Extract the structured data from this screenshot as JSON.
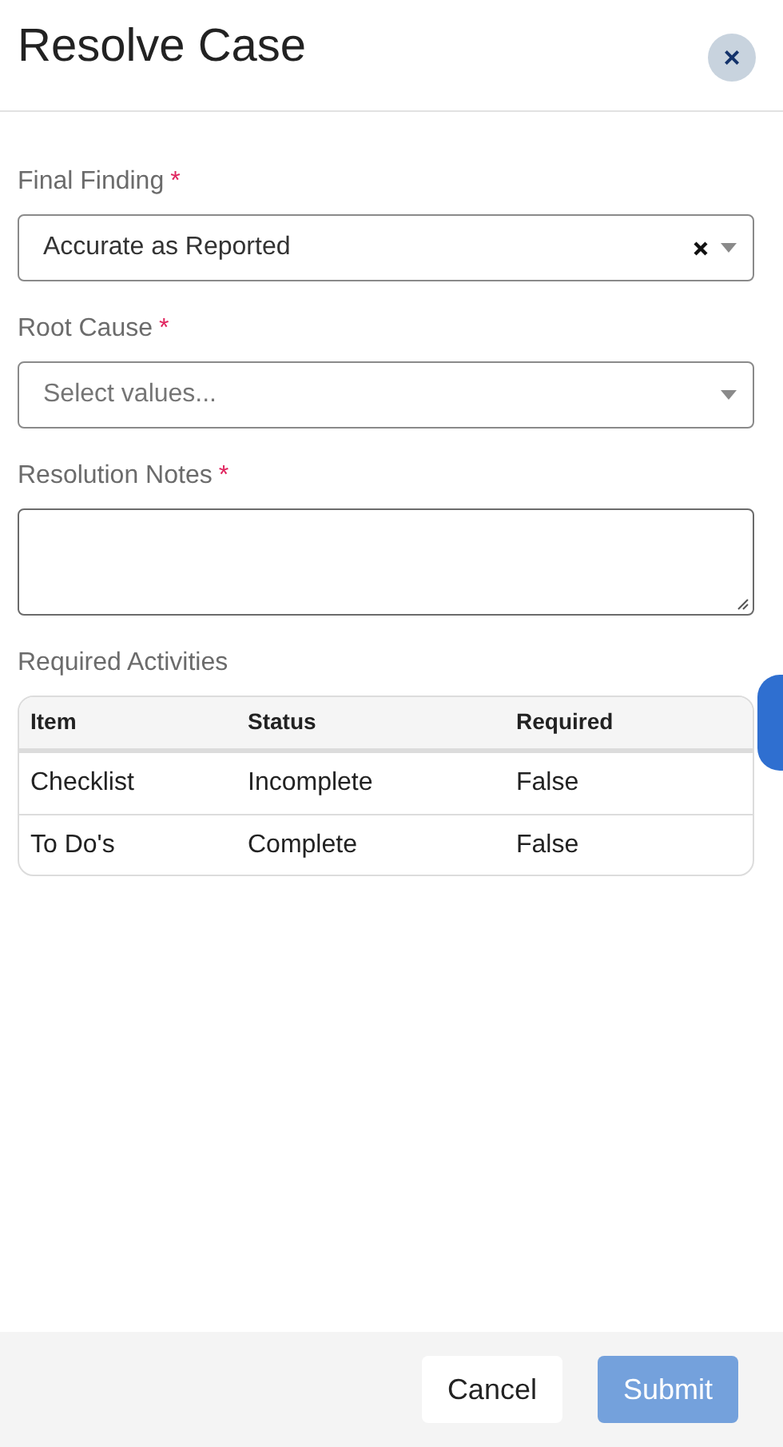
{
  "dialog": {
    "title": "Resolve Case",
    "close_label": "×"
  },
  "fields": [
    {
      "kind": "select",
      "label": "Final Finding",
      "required_mark": "*",
      "value": "Accurate as Reported",
      "clearable": true
    },
    {
      "kind": "select",
      "label": "Root Cause",
      "required_mark": "*",
      "placeholder": "Select values...",
      "clearable": false
    },
    {
      "kind": "textarea",
      "label": "Resolution Notes",
      "required_mark": "*"
    }
  ],
  "activities": {
    "title": "Required Activities",
    "columns": [
      "Item",
      "Status",
      "Required"
    ],
    "rows": [
      [
        "Checklist",
        "Incomplete",
        "False"
      ],
      [
        "To Do's",
        "Complete",
        "False"
      ]
    ]
  },
  "buttons": [
    {
      "label": "Cancel",
      "kind": "secondary",
      "disabled": false
    },
    {
      "label": "Submit",
      "kind": "primary",
      "disabled": true
    }
  ]
}
